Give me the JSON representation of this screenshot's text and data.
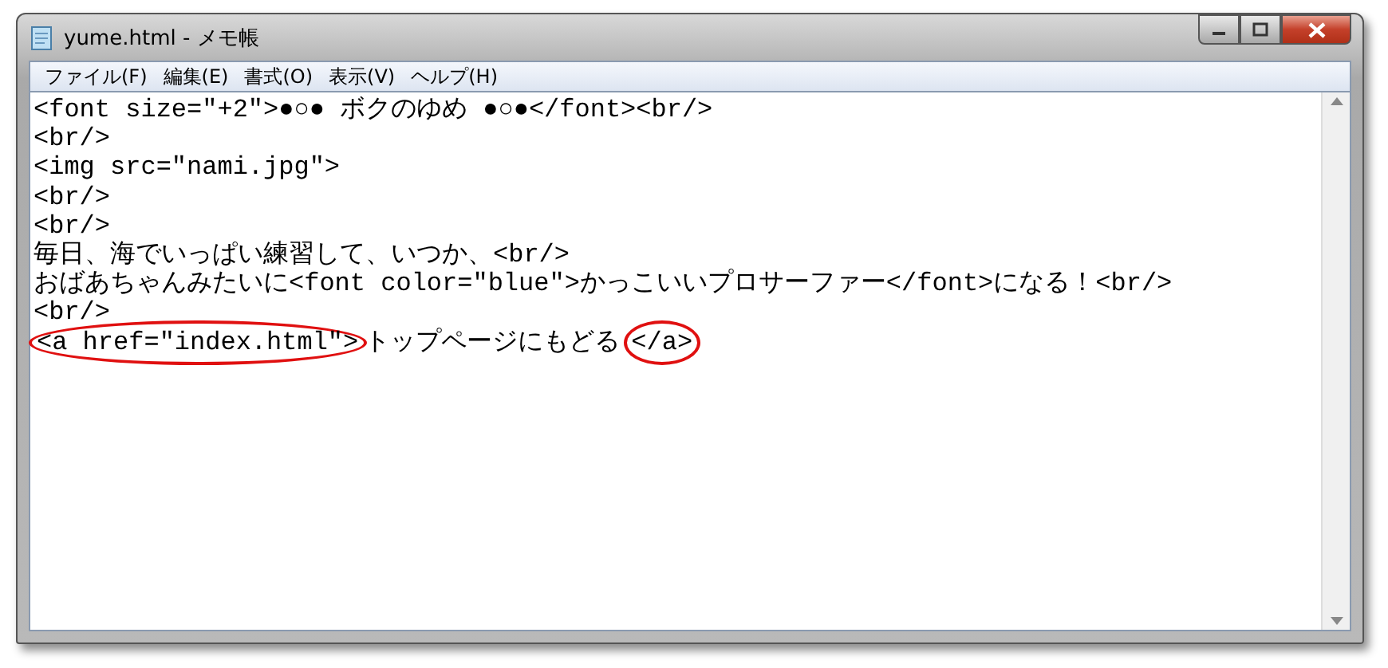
{
  "window": {
    "title": "yume.html - メモ帳"
  },
  "menu": [
    {
      "label": "ファイル(F)"
    },
    {
      "label": "編集(E)"
    },
    {
      "label": "書式(O)"
    },
    {
      "label": "表示(V)"
    },
    {
      "label": "ヘルプ(H)"
    }
  ],
  "lines": [
    {
      "segments": [
        {
          "text": "<font size=\"+2\">●○● ボクのゆめ ●○●</font><br/>",
          "circled": false
        }
      ]
    },
    {
      "segments": [
        {
          "text": "<br/>",
          "circled": false
        }
      ]
    },
    {
      "segments": [
        {
          "text": "<img src=\"nami.jpg\">",
          "circled": false
        }
      ]
    },
    {
      "segments": [
        {
          "text": "<br/>",
          "circled": false
        }
      ]
    },
    {
      "segments": [
        {
          "text": "<br/>",
          "circled": false
        }
      ]
    },
    {
      "segments": [
        {
          "text": "毎日、海でいっぱい練習して、いつか、<br/>",
          "circled": false
        }
      ]
    },
    {
      "segments": [
        {
          "text": "おばあちゃんみたいに<font color=\"blue\">かっこいいプロサーファー</font>になる！<br/>",
          "circled": false
        }
      ]
    },
    {
      "segments": [
        {
          "text": "<br/>",
          "circled": false
        }
      ]
    },
    {
      "segments": [
        {
          "text": "<a href=\"index.html\">",
          "circled": true
        },
        {
          "text": "トップページにもどる",
          "circled": false
        },
        {
          "text": "</a>",
          "circled": true
        }
      ]
    }
  ]
}
